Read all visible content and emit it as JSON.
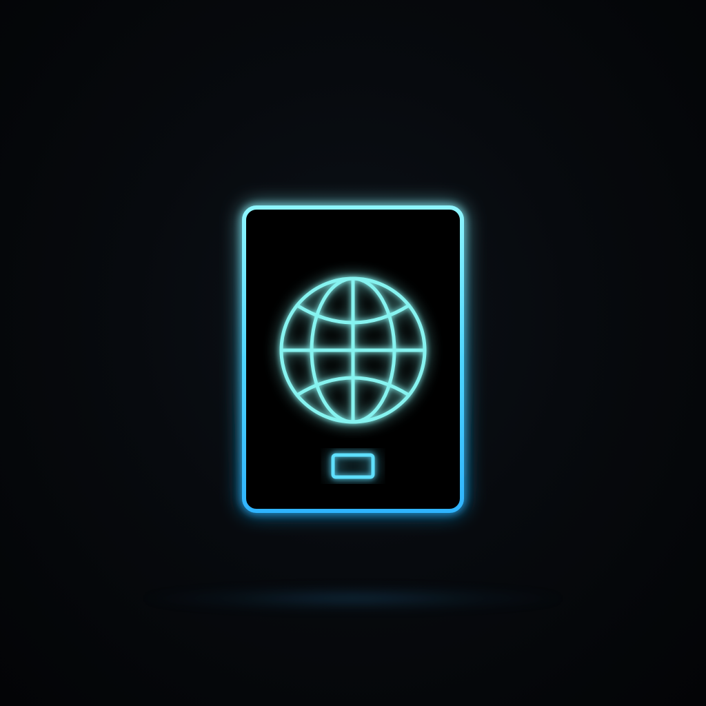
{
  "scene": {
    "subject_icon": "passport-icon",
    "emblem_icon": "globe-icon",
    "accent_color": "#39c6ff",
    "globe_color": "#7ff0f0",
    "background_color": "#05070a"
  }
}
